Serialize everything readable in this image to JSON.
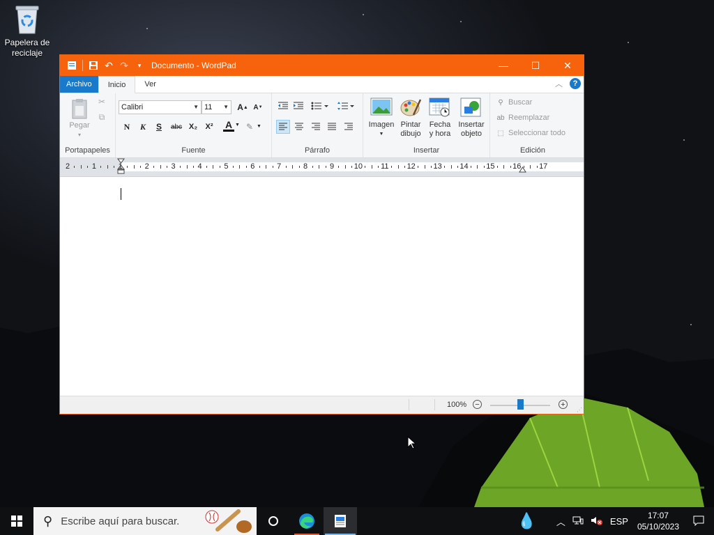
{
  "desktop": {
    "recycle_bin_label": "Papelera de reciclaje"
  },
  "window": {
    "title": "Documento - WordPad",
    "accent": "#f7630c",
    "controls": {
      "minimize": "—",
      "maximize": "☐",
      "close": "✕"
    }
  },
  "tabs": {
    "file": "Archivo",
    "home": "Inicio",
    "view": "Ver"
  },
  "ribbon": {
    "clipboard": {
      "paste": "Pegar",
      "label": "Portapapeles"
    },
    "font": {
      "family": "Calibri",
      "size": "11",
      "label": "Fuente",
      "bold": "N",
      "italic": "K",
      "underline": "S",
      "strike": "abc",
      "subscript": "X₂",
      "superscript": "X²",
      "grow": "A",
      "shrink": "A",
      "color_letter": "A"
    },
    "paragraph": {
      "label": "Párrafo"
    },
    "insert": {
      "image": "Imagen",
      "paint_line1": "Pintar",
      "paint_line2": "dibujo",
      "datetime_line1": "Fecha",
      "datetime_line2": "y hora",
      "object_line1": "Insertar",
      "object_line2": "objeto",
      "label": "Insertar"
    },
    "editing": {
      "find": "Buscar",
      "replace": "Reemplazar",
      "select_all": "Seleccionar todo",
      "label": "Edición"
    }
  },
  "ruler": {
    "labels": [
      "2",
      "1",
      "1",
      "2",
      "3",
      "4",
      "5",
      "6",
      "7",
      "8",
      "9",
      "10",
      "11",
      "12",
      "13",
      "14",
      "15",
      "16",
      "17"
    ]
  },
  "status": {
    "zoom": "100%",
    "zoom_level": 0.5
  },
  "taskbar": {
    "search_placeholder": "Escribe aquí para buscar.",
    "language": "ESP",
    "time": "17:07",
    "date": "05/10/2023"
  }
}
